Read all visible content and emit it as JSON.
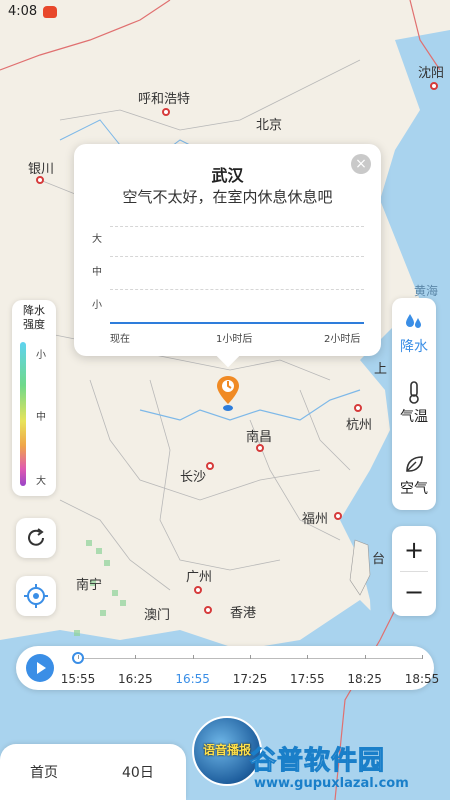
{
  "status_bar": {
    "time": "4:08"
  },
  "map": {
    "cities": [
      {
        "name": "呼和浩特"
      },
      {
        "name": "北京"
      },
      {
        "name": "沈阳"
      },
      {
        "name": "银川"
      },
      {
        "name": "南昌"
      },
      {
        "name": "杭州"
      },
      {
        "name": "长沙"
      },
      {
        "name": "福州"
      },
      {
        "name": "广州"
      },
      {
        "name": "南宁"
      },
      {
        "name": "澳门"
      },
      {
        "name": "香港"
      },
      {
        "name": "台"
      },
      {
        "name": "上"
      }
    ],
    "sea_label": "黄海"
  },
  "popup": {
    "city": "武汉",
    "message": "空气不太好，在室内休息休息吧",
    "close_icon": "close-icon",
    "y_labels": [
      "大",
      "中",
      "小"
    ],
    "x_labels": [
      "现在",
      "1小时后",
      "2小时后"
    ]
  },
  "legend": {
    "title_line1": "降水",
    "title_line2": "强度",
    "levels": [
      "小",
      "中",
      "大"
    ]
  },
  "layers": [
    {
      "label": "降水",
      "icon": "raindrop-icon",
      "active": true
    },
    {
      "label": "气温",
      "icon": "thermometer-icon",
      "active": false
    },
    {
      "label": "空气",
      "icon": "leaf-icon",
      "active": false
    }
  ],
  "zoom": {
    "in": "+",
    "out": "−"
  },
  "timeline": {
    "times": [
      "15:55",
      "16:25",
      "16:55",
      "17:25",
      "17:55",
      "18:25",
      "18:55"
    ],
    "highlight_index": 2,
    "progress": 0
  },
  "bottom": {
    "tab_home": "首页",
    "tab_40d": "40日",
    "voice": "语音播报"
  },
  "watermark": {
    "big": "谷普软件园",
    "small": "www.gupuxlazal.com"
  },
  "colors": {
    "accent": "#3a8ee6",
    "city_dot": "#d63b3b",
    "water": "#a9d3ee"
  }
}
